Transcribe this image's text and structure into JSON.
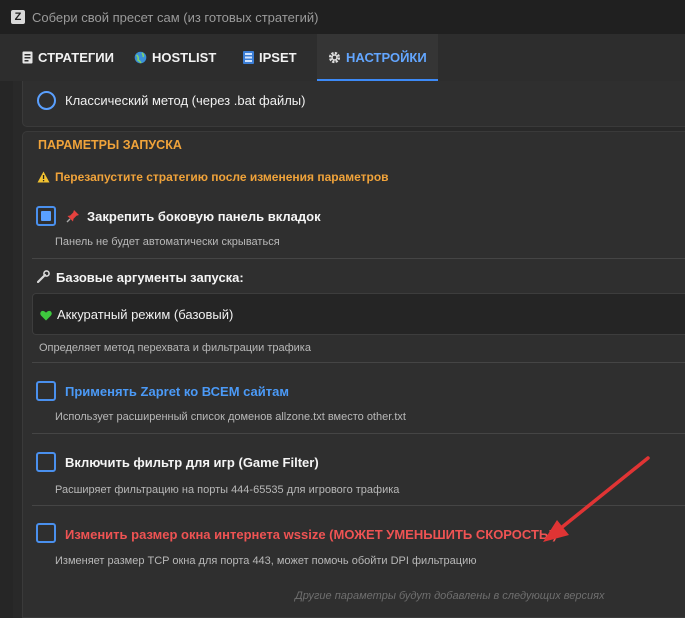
{
  "window": {
    "title": "Собери свой пресет сам (из готовых стратегий)",
    "app_icon_text": "Z"
  },
  "tabs": [
    {
      "label": "СТРАТЕГИИ",
      "icon": "document-icon",
      "active": false
    },
    {
      "label": "HOSTLIST",
      "icon": "globe-icon",
      "active": false
    },
    {
      "label": "IPSET",
      "icon": "server-icon",
      "active": false
    },
    {
      "label": "НАСТРОЙКИ",
      "icon": "gear-icon",
      "active": true
    }
  ],
  "method": {
    "label": "Классический метод (через .bat файлы)",
    "selected": false
  },
  "launch_params": {
    "section_title": "ПАРАМЕТРЫ ЗАПУСКА",
    "warning": "Перезапустите стратегию после изменения параметров",
    "pin_sidebar": {
      "label": "Закрепить боковую панель вкладок",
      "description": "Панель не будет автоматически скрываться",
      "checked": true
    },
    "base_args": {
      "label": "Базовые аргументы запуска:",
      "selected_value": "Аккуратный режим (базовый)",
      "description": "Определяет метод перехвата и фильтрации трафика"
    },
    "apply_all": {
      "label": "Применять Zapret ко ВСЕМ сайтам",
      "description": "Использует расширенный список доменов allzone.txt вместо other.txt",
      "checked": false
    },
    "game_filter": {
      "label": "Включить фильтр для игр (Game Filter)",
      "description": "Расширяет фильтрацию на порты 444-65535 для игрового трафика",
      "checked": false
    },
    "wssize": {
      "label": "Изменить размер окна интернета wssize (МОЖЕТ УМЕНЬШИТЬ СКОРОСТЬ!)",
      "description": "Изменяет размер TCP окна для порта 443, может помочь обойти DPI фильтрацию",
      "checked": false
    },
    "footnote": "Другие параметры будут добавлены в следующих версиях"
  },
  "colors": {
    "accent": "#3d8af7",
    "warning": "#f0a33a",
    "danger": "#ef5353",
    "annotation_arrow": "#e03434"
  }
}
